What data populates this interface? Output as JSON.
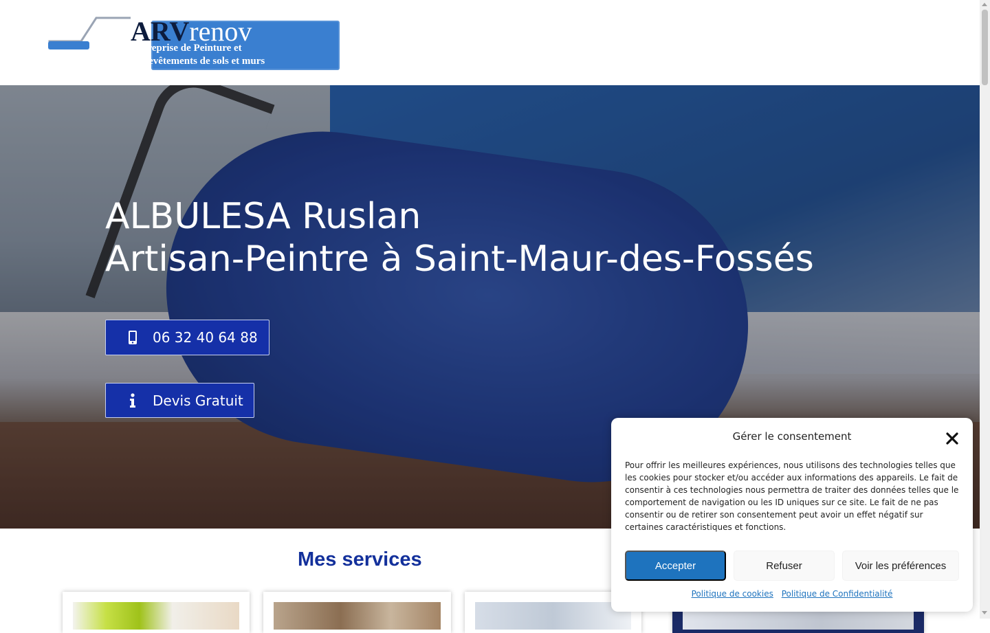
{
  "header": {
    "logo": {
      "brand_bold": "ARV",
      "brand_light": "renov",
      "tagline_line1": "Entreprise de Peinture et",
      "tagline_line2": "de revêtements de sols et murs",
      "colors": {
        "banner": "#3a7fd0",
        "brand_text": "#0d1c3d"
      }
    }
  },
  "hero": {
    "title_line1": "ALBULESA Ruslan",
    "title_line2": "Artisan-Peintre à Saint-Maur-des-Fossés",
    "phone_button": {
      "label": "06 32 40 64 88",
      "icon": "mobile-phone-icon"
    },
    "quote_button": {
      "label": "Devis Gratuit",
      "icon": "info-icon"
    },
    "colors": {
      "button_bg": "#1530a8"
    }
  },
  "services": {
    "title": "Mes services",
    "title_color": "#13309b"
  },
  "consent": {
    "title": "Gérer le consentement",
    "body": "Pour offrir les meilleures expériences, nous utilisons des technologies telles que les cookies pour stocker et/ou accéder aux informations des appareils. Le fait de consentir à ces technologies nous permettra de traiter des données telles que le comportement de navigation ou les ID uniques sur ce site. Le fait de ne pas consentir ou de retirer son consentement peut avoir un effet négatif sur certaines caractéristiques et fonctions.",
    "accept_label": "Accepter",
    "refuse_label": "Refuser",
    "preferences_label": "Voir les préférences",
    "cookie_policy_link": "Politique de cookies",
    "privacy_policy_link": "Politique de Confidentialité",
    "close_icon": "close-icon",
    "colors": {
      "accept_bg": "#1e73be",
      "link": "#1e73be"
    }
  }
}
